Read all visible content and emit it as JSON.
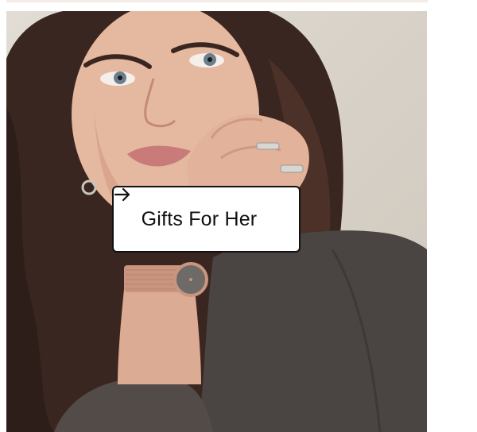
{
  "hero": {
    "image_subject": "model-wearing-rose-gold-watch-and-rings",
    "cta_label": "Gifts For Her",
    "cta_icon": "arrow-right-icon"
  },
  "colors": {
    "background": "#ffffff",
    "button_bg": "#ffffff",
    "button_border": "#111111",
    "text": "#111111",
    "rose_gold": "#c9957f",
    "jacket": "#4a4442",
    "hair": "#3a2620"
  }
}
